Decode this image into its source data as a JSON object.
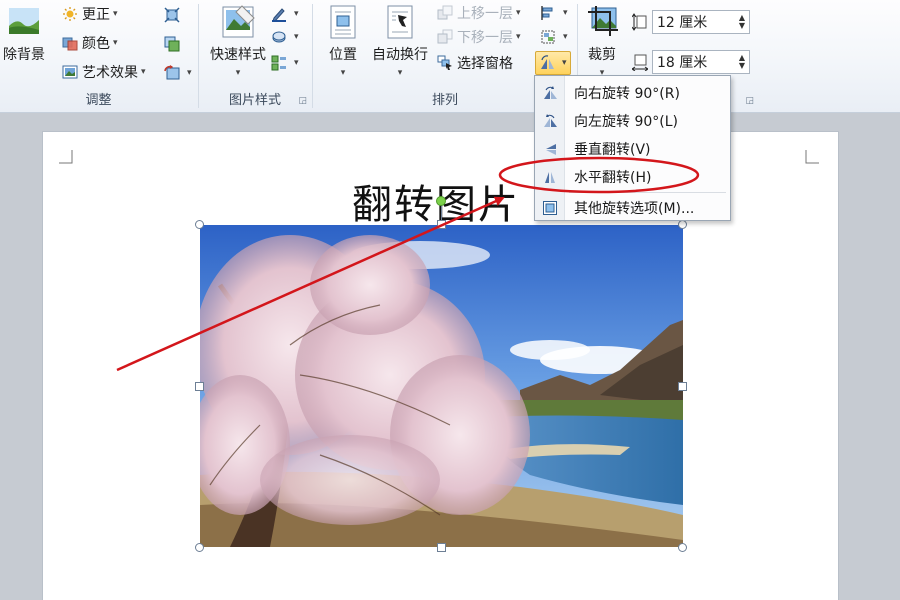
{
  "ribbon": {
    "adjust": {
      "remove_bg": "除背景",
      "corrections": "更正",
      "color": "颜色",
      "art_effects": "艺术效果",
      "group_label": "调整"
    },
    "picture_styles": {
      "quick_styles": "快速样式",
      "group_label": "图片样式"
    },
    "arrange": {
      "position": "位置",
      "wrap_text": "自动换行",
      "bring_forward": "上移一层",
      "send_backward": "下移一层",
      "selection_pane": "选择窗格",
      "group_label": "排列"
    },
    "size": {
      "crop": "裁剪",
      "height_value": "12 厘米",
      "width_value": "18 厘米"
    }
  },
  "document": {
    "title": "翻转图片"
  },
  "rotate_menu": {
    "items": [
      {
        "label": "向右旋转 90°(R)"
      },
      {
        "label": "向左旋转 90°(L)"
      },
      {
        "label": "垂直翻转(V)"
      },
      {
        "label": "水平翻转(H)"
      },
      {
        "label": "其他旋转选项(M)..."
      }
    ],
    "highlighted_item": "水平翻转(H)"
  },
  "annotation": {
    "color": "#d3161b"
  }
}
